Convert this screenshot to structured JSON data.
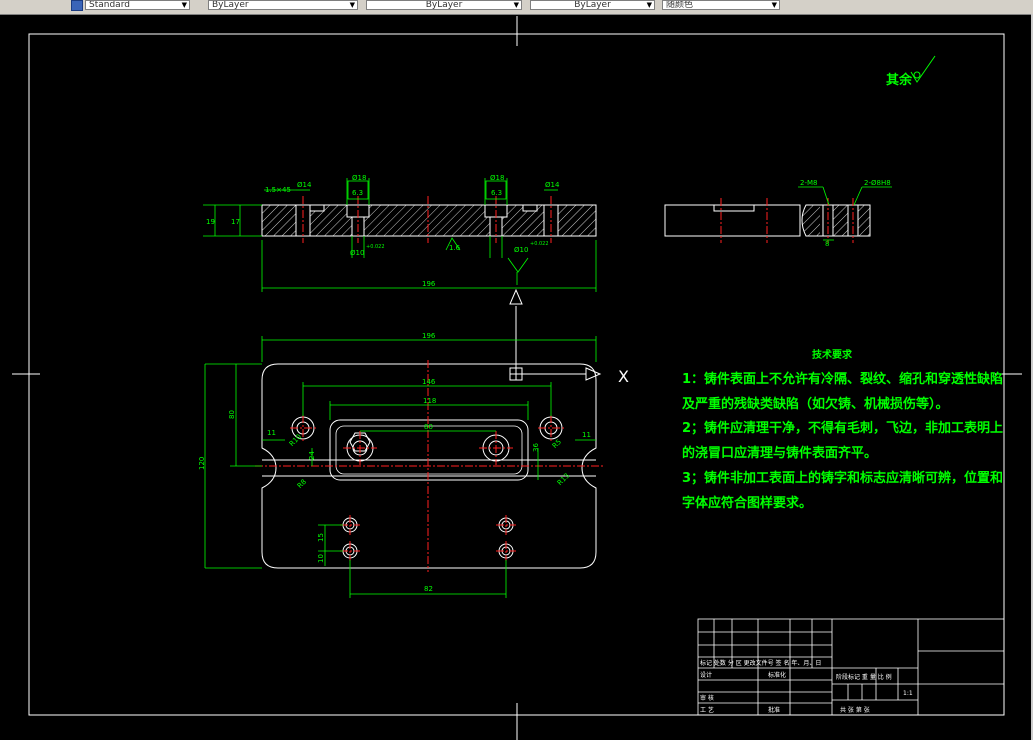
{
  "toolbar": {
    "text_style": "Standard",
    "layer": "ByLayer",
    "linetype": "ByLayer",
    "lineweight": "ByLayer",
    "color": "随颜色"
  },
  "drawing": {
    "surface_note": "其余",
    "tech_title": "技术要求",
    "tech_lines": [
      "1：铸件表面上不允许有冷隔、裂纹、缩孔和穿透性缺陷",
      "及严重的残缺类缺陷（如欠铸、机械损伤等）。",
      "2；铸件应清理干净，不得有毛刺，飞边，非加工表明上",
      "的浇冒口应清理与铸件表面齐平。",
      "3；铸件非加工表面上的铸字和标志应清晰可辨，位置和",
      "字体应符合图样要求。"
    ],
    "section_dims": {
      "d14_left": "Ø14",
      "d18_left": "Ø18",
      "d18_right": "Ø18",
      "d14_right": "Ø14",
      "ra_left": "6.3",
      "ra_right": "6.3",
      "chamfer": "1.5×45",
      "h19": "19",
      "h17": "17",
      "d10_left": "Ø10",
      "tol_left": "+0.022",
      "d10_right": "Ø10",
      "tol_right": "+0.022",
      "ra16": "1.6",
      "len196": "196"
    },
    "side_dims": {
      "m8": "2-M8",
      "h8": "2-Ø8H8",
      "w8": "8"
    },
    "plan_dims": {
      "w196": "196",
      "w146": "146",
      "w118": "118",
      "w80": "80",
      "w82": "82",
      "h120": "120",
      "h80": "80",
      "h36": "36",
      "h24": "24",
      "h15": "15",
      "h10": "10",
      "d11_left": "11",
      "d11_right": "11",
      "r10": "R10",
      "r8": "R8",
      "r5": "R5",
      "r13": "R13"
    },
    "view_marker": "X",
    "title_block": {
      "r1": "标记  处数  分 区  更改文件号  签 名  年、月、日",
      "design": "设计",
      "standard": "标准化",
      "stage": "阶段标记   重 量   比 例",
      "scale": "1:1",
      "review": "审 核",
      "craft": "工 艺",
      "approve": "批准",
      "sheets": "共    张   第    张"
    }
  }
}
